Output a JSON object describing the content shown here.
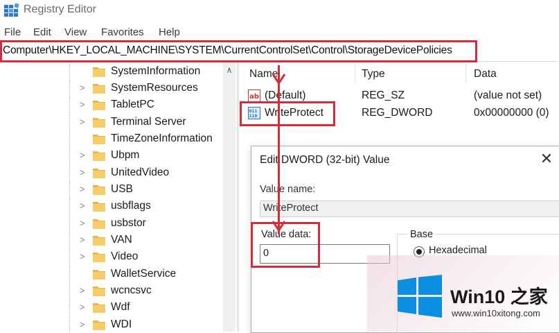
{
  "window": {
    "title": "Registry Editor",
    "icon": "registry-editor-icon"
  },
  "menu": [
    "File",
    "Edit",
    "View",
    "Favorites",
    "Help"
  ],
  "address": {
    "path": "Computer\\HKEY_LOCAL_MACHINE\\SYSTEM\\CurrentControlSet\\Control\\StorageDevicePolicies"
  },
  "tree": {
    "items": [
      "SystemInformation",
      "SystemResources",
      "TabletPC",
      "Terminal Server",
      "TimeZoneInformation",
      "Ubpm",
      "UnitedVideo",
      "USB",
      "usbflags",
      "usbstor",
      "VAN",
      "Video",
      "WalletService",
      "wcncsvc",
      "Wdf",
      "WDI"
    ]
  },
  "list": {
    "columns": {
      "name": "Name",
      "type": "Type",
      "data": "Data"
    },
    "rows": [
      {
        "icon": "string-value-icon",
        "name": "(Default)",
        "type": "REG_SZ",
        "data": "(value not set)"
      },
      {
        "icon": "dword-value-icon",
        "name": "WriteProtect",
        "type": "REG_DWORD",
        "data": "0x00000000 (0)"
      }
    ]
  },
  "dialog": {
    "title": "Edit DWORD (32-bit) Value",
    "value_name_label": "Value name:",
    "value_name": "WriteProtect",
    "value_data_label": "Value data:",
    "value_data": "0",
    "base_label": "Base",
    "base_selected": "Hexadecimal"
  },
  "watermark": {
    "brand": "Win10 之家",
    "url": "www.win10xitong.com"
  },
  "colors": {
    "highlight": "#d42a3a",
    "folder": "#e8b64a",
    "win_blue": "#0a8ee0"
  }
}
